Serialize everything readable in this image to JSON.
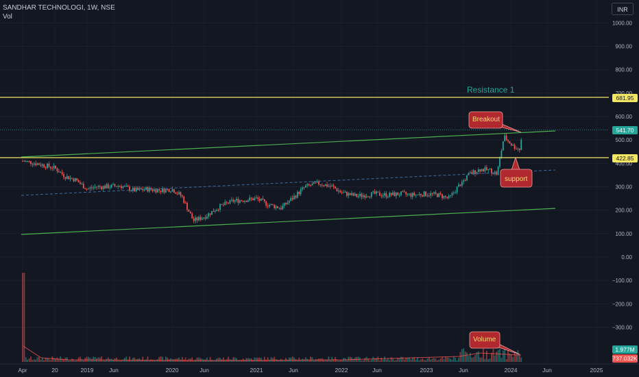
{
  "header": {
    "symbol": "SANDHAR TECHNOLOGI, 1W, NSE",
    "volume_label": "Vol"
  },
  "currency_button": "INR",
  "price_axis_labels": [
    "1000.00",
    "900.00",
    "800.00",
    "700.00",
    "600.00",
    "500.00",
    "400.00",
    "300.00",
    "200.00",
    "100.00",
    "0.00",
    "−100.00",
    "−200.00",
    "−300.00"
  ],
  "price_axis_values": [
    1000,
    900,
    800,
    700,
    600,
    500,
    400,
    300,
    200,
    100,
    0,
    -100,
    -200,
    -300
  ],
  "time_axis_labels": [
    "Apr",
    "20",
    "2019",
    "Jun",
    "2020",
    "Jun",
    "2021",
    "Jun",
    "2022",
    "Jun",
    "2023",
    "Jun",
    "2024",
    "Jun",
    "2025"
  ],
  "price_tags": {
    "resistance": "681.95",
    "current": "541.70",
    "support": "422.85",
    "volume": "1.977M",
    "volume_ma": "737.032K"
  },
  "annotations": {
    "resistance": "Resistance 1",
    "breakout": "Breakout",
    "support": "support",
    "volume": "Volume"
  },
  "colors": {
    "background": "#131722",
    "up": "#26a69a",
    "down": "#ef5350",
    "level_line": "#f5e663",
    "channel": "#4caf50",
    "midline": "#3a6ea5",
    "callout": "#b2282f",
    "resistance_text": "#26a69a"
  }
}
